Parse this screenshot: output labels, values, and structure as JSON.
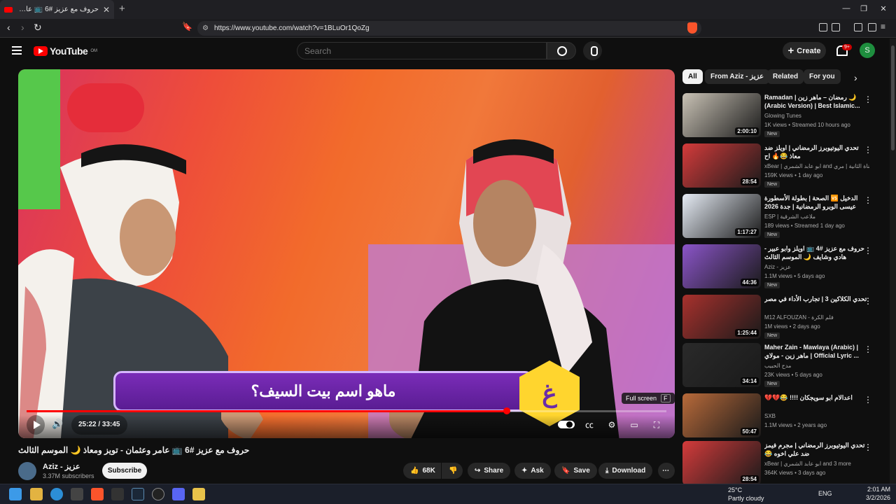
{
  "browser": {
    "tab_title": "حروف مع عزيز #6 📺 عامر و...",
    "tab_badge": "(12)",
    "url": "https://www.youtube.com/watch?v=1BLuOr1QoZg"
  },
  "header": {
    "logo": "YouTube",
    "country": "OM",
    "search_placeholder": "Search",
    "create_label": "Create",
    "notif_count": "9+",
    "avatar_letter": "S"
  },
  "player": {
    "question_text": "ماهو اسم بيت السيف؟",
    "hex_letter": "غ",
    "time": "25:22 / 33:45",
    "progress": 0.751,
    "tooltip": "Full screen",
    "tooltip_key": "F"
  },
  "video": {
    "title": "حروف مع عزيز #6 📺 عامر وعثمان - تويز ومعاذ 🌙 الموسم الثالث",
    "channel": "Aziz - عزيز",
    "subs": "3.37M subscribers",
    "subscribe": "Subscribe",
    "likes": "68K",
    "share": "Share",
    "ask": "Ask",
    "save": "Save",
    "download": "Download"
  },
  "chips": [
    "All",
    "From Aziz - عزيز",
    "Related",
    "For you"
  ],
  "recs": [
    {
      "title": "Ramadan | رمضان – ماهر زين 🌙 (Arabic Version) | Best Islamic...",
      "channel": "Glowing Tunes",
      "meta": "1K views • Streamed 10 hours ago",
      "dur": "2:00:10",
      "new": "New",
      "color": "#c9c2b5"
    },
    {
      "title": "تحدي اليوتيوبرز الرمضاني | اويلز ضد معاذ 😂🔥 اح",
      "channel": "xBear | ابو عابد الشمري and القناة الثانية | مري",
      "meta": "159K views • 1 day ago",
      "dur": "28:54",
      "new": "New",
      "color": "#d43b3b"
    },
    {
      "title": "الدخيل 🆚 الصحة | بطولة الأسطورة عيسى الوبرو الرمضانية | جدة 2026",
      "channel": "ESP | ملاعب الشرقية",
      "meta": "189 views • Streamed 1 day ago",
      "dur": "1:17:27",
      "new": "New",
      "color": "#e6ecf5"
    },
    {
      "title": "حروف مع عزيز #4 📺 اويلز وابو عبير - هادي وشايف 🌙 الموسم الثالث",
      "channel": "Aziz - عزيز",
      "meta": "1.1M views • 5 days ago",
      "dur": "44:36",
      "new": "New",
      "color": "#8b55c9"
    },
    {
      "title": "تحدي الكلاكين 3 | تجارب الأداء في مصر",
      "channel": "M12 ALFOUZAN - فلم الكرة",
      "meta": "1M views • 2 days ago",
      "dur": "1:25:44",
      "new": "New",
      "color": "#a8312d"
    },
    {
      "title": "Maher Zain - Mawlaya (Arabic) | ماهر زين - مولاي | Official Lyric ...",
      "channel": "مدح الحبيب",
      "meta": "23K views • 5 days ago",
      "dur": "34:14",
      "new": "New",
      "color": "#2a2a2a"
    },
    {
      "title": "اعدالام ابو سويجكان !!!! 😂💔💔",
      "channel": "SXB",
      "meta": "1.1M views • 2 years ago",
      "dur": "50:47",
      "new": "",
      "color": "#b86a3a"
    },
    {
      "title": "تحدي اليوتيوبرز الرمضاني | مجرم فيمز ضد علي اخوه 😂",
      "channel": "xBear | ابو عابد الشمري and 3 more",
      "meta": "364K views • 3 days ago",
      "dur": "28:54",
      "new": "",
      "color": "#d43b3b"
    }
  ],
  "taskbar": {
    "temp": "25°C",
    "weather": "Partly cloudy",
    "lang": "ENG",
    "time": "2:01 AM",
    "date": "3/2/2026"
  }
}
